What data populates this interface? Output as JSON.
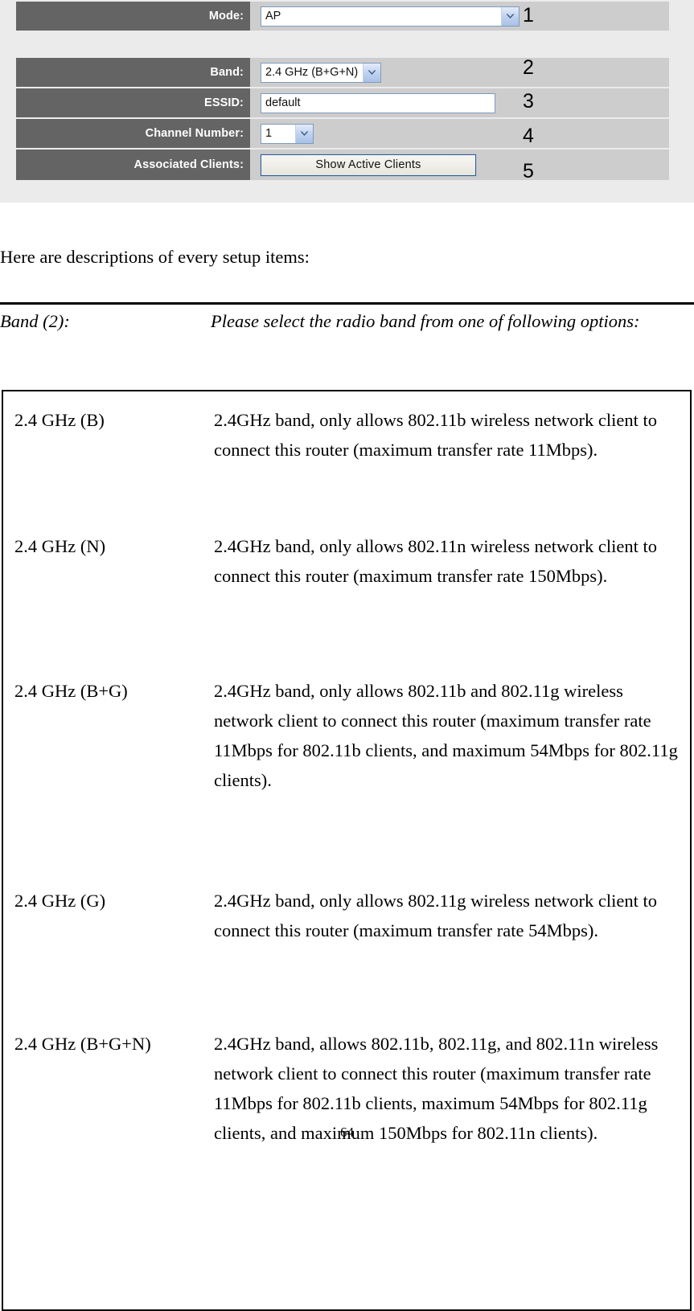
{
  "router_ui": {
    "block_a": [
      {
        "label": "Mode:",
        "control": "select",
        "value": "AP",
        "index": "1"
      }
    ],
    "block_b": [
      {
        "label": "Band:",
        "control": "select",
        "value": "2.4 GHz (B+G+N)",
        "index": "2"
      },
      {
        "label": "ESSID:",
        "control": "text",
        "value": "default",
        "index": "3"
      },
      {
        "label": "Channel Number:",
        "control": "select",
        "value": "1",
        "index": "4"
      },
      {
        "label": "Associated Clients:",
        "control": "button",
        "value": "Show Active Clients",
        "index": "5"
      }
    ],
    "colors": {
      "label_cell": "#646464",
      "value_cell": "#cdcdcd",
      "panel_bg": "#ebebeb",
      "field_border": "#7d9bbd",
      "arrow_fill": "#bdd0ee",
      "button_border": "#2f5c92"
    }
  },
  "document": {
    "intro": "Here are descriptions of every setup items:",
    "definition": {
      "term": "Band (2):",
      "description": "Please select the radio band from one of following options:"
    },
    "options": [
      {
        "term": "2.4 GHz (B)",
        "description": "2.4GHz band, only allows 802.11b wireless network client to connect this router (maximum transfer rate 11Mbps)."
      },
      {
        "term": "2.4 GHz (N)",
        "description": "2.4GHz band, only allows 802.11n wireless network client to connect this router (maximum transfer rate 150Mbps)."
      },
      {
        "term": "2.4 GHz (B+G)",
        "description": "2.4GHz band, only allows 802.11b and 802.11g wireless network client to connect this router (maximum transfer rate 11Mbps for 802.11b clients, and maximum 54Mbps for 802.11g clients)."
      },
      {
        "term": "2.4 GHz (G)",
        "description": "2.4GHz band, only allows 802.11g wireless network client to connect this router (maximum transfer rate 54Mbps)."
      },
      {
        "term": "2.4 GHz (B+G+N)",
        "description": "2.4GHz band, allows 802.11b, 802.11g, and 802.11n wireless network client to connect this router (maximum transfer rate 11Mbps for 802.11b clients, maximum 54Mbps for 802.11g clients, and maximum 150Mbps for 802.11n clients)."
      }
    ],
    "page_number": "64"
  }
}
